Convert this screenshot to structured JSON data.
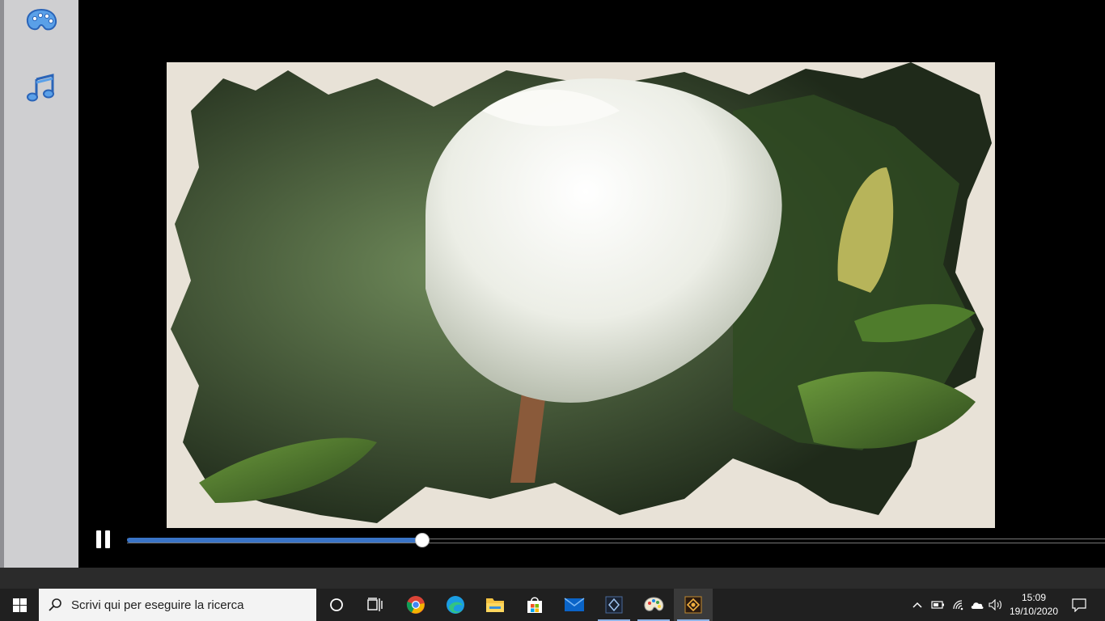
{
  "side_panel": {
    "items": [
      {
        "icon": "palette-icon"
      },
      {
        "icon": "music-note-icon"
      }
    ],
    "icon_color": "#3b82d6"
  },
  "player": {
    "state": "playing",
    "progress_fraction": 0.302,
    "accent_color": "#3a74c6"
  },
  "taskbar": {
    "search": {
      "placeholder": "Scrivi qui per eseguire la ricerca"
    },
    "pinned_apps": [
      "chrome-icon",
      "edge-icon",
      "file-explorer-icon",
      "microsoft-store-icon",
      "mail-icon",
      "app-icon",
      "paint-icon",
      "video-editor-icon"
    ],
    "clock": {
      "time": "15:09",
      "date": "19/10/2020"
    }
  }
}
